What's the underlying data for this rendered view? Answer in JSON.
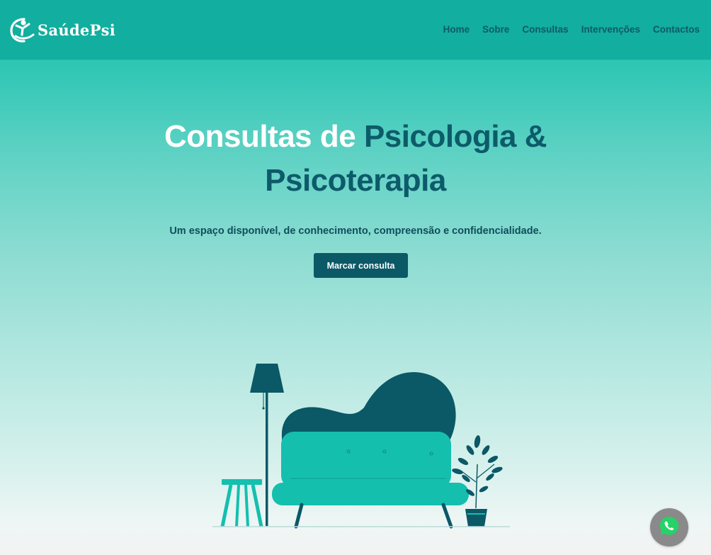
{
  "brand": {
    "name": "SaúdePsi",
    "logo_icon": "person-figure-icon"
  },
  "nav": {
    "items": [
      {
        "label": "Home"
      },
      {
        "label": "Sobre"
      },
      {
        "label": "Consultas"
      },
      {
        "label": "Intervenções"
      },
      {
        "label": "Contactos"
      }
    ]
  },
  "hero": {
    "title_part1": "Consultas de ",
    "title_part2": "Psicologia &",
    "title_part3": "Psicoterapia",
    "subtitle": "Um espaço disponível, de conhecimento, compreensão e confidencialidade.",
    "cta_label": "Marcar consulta"
  },
  "illustration": {
    "icon": "therapy-sofa-illustration"
  },
  "floating": {
    "icon": "whatsapp-icon"
  },
  "colors": {
    "header": "#12ae9f",
    "accent_dark": "#0b5866",
    "teal": "#14bfae",
    "title_white": "#ffffff"
  }
}
